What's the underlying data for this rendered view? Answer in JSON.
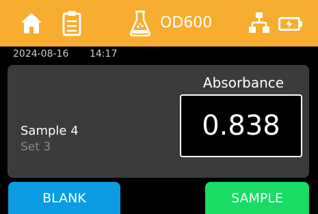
{
  "header": {
    "icons": [
      "home-icon",
      "clipboard-icon",
      "flask-icon",
      "network-icon",
      "battery-icon"
    ],
    "mode_title": "OD600",
    "bar_color": "#f7ad2f"
  },
  "status": {
    "date": "2024-08-16",
    "time": "14:17"
  },
  "reading": {
    "label": "Absorbance",
    "value": "0.838",
    "sample_name": "Sample 4",
    "set_name": "Set 3"
  },
  "actions": {
    "blank_label": "BLANK",
    "blank_color": "#0a9be3",
    "sample_label": "SAMPLE",
    "sample_color": "#18dc64"
  }
}
